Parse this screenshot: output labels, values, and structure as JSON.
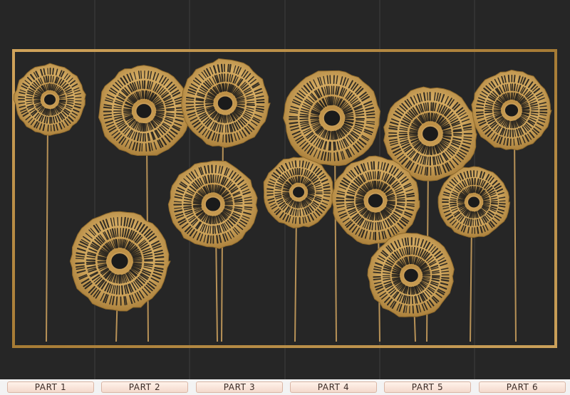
{
  "image": {
    "subject": "metal-wall-art",
    "colors": {
      "wall": "#262626",
      "panel_divider": "#3a3a3a",
      "frame_gold": "#b8893f",
      "disc_gold": "#c9a058",
      "disc_dark": "#1b1b1b",
      "stem_gold": "#b89257",
      "label_bg": "#fbe6dc",
      "label_border": "#d9b6a5"
    }
  },
  "parts": [
    "PART 1",
    "PART 2",
    "PART 3",
    "PART 4",
    "PART 5",
    "PART 6"
  ]
}
